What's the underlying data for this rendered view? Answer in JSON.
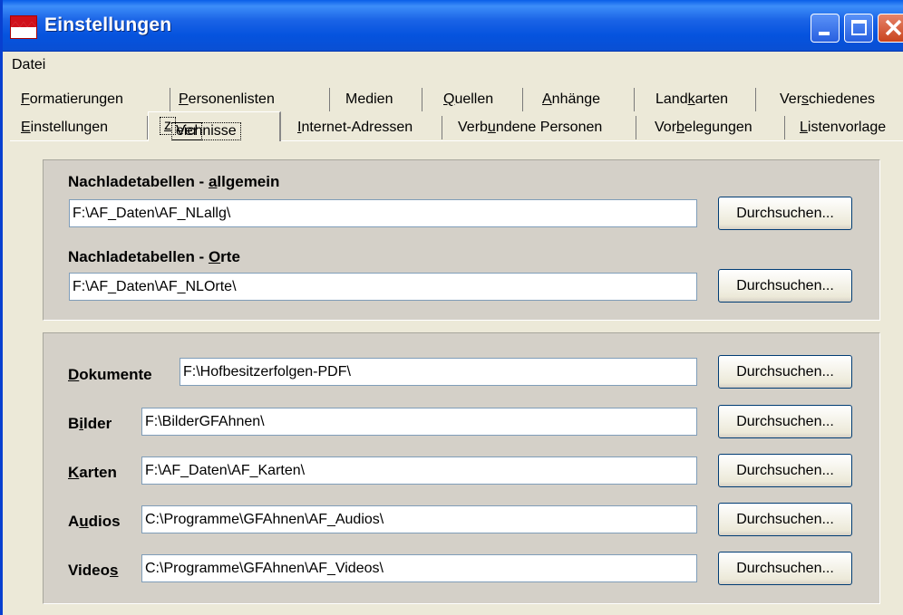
{
  "window": {
    "title": "Einstellungen"
  },
  "menu": {
    "items": [
      "Datei"
    ]
  },
  "tabs_row1": [
    {
      "pre": "",
      "key": "F",
      "post": "ormatierungen"
    },
    {
      "pre": "",
      "key": "P",
      "post": "ersonenlisten"
    },
    {
      "pre": "Medien",
      "key": "",
      "post": ""
    },
    {
      "pre": "",
      "key": "Q",
      "post": "uellen"
    },
    {
      "pre": "",
      "key": "A",
      "post": "nhänge"
    },
    {
      "pre": "Land",
      "key": "k",
      "post": "arten"
    },
    {
      "pre": "Ver",
      "key": "s",
      "post": "chiedenes"
    }
  ],
  "tabs_row2": [
    {
      "pre": "",
      "key": "E",
      "post": "instellungen"
    },
    {
      "pre": "Ver",
      "key": "z",
      "post": "eichnisse"
    },
    {
      "pre": "",
      "key": "I",
      "post": "nternet-Adressen"
    },
    {
      "pre": "Verb",
      "key": "u",
      "post": "ndene Personen"
    },
    {
      "pre": "Vor",
      "key": "b",
      "post": "elegungen"
    },
    {
      "pre": "",
      "key": "L",
      "post": "istenvorlage"
    }
  ],
  "nachlade": {
    "allgemein": {
      "label_pre": "Nachladetabellen - ",
      "label_key": "a",
      "label_post": "llgemein",
      "value": "F:\\AF_Daten\\AF_NLallg\\"
    },
    "orte": {
      "label_pre": "Nachladetabellen - ",
      "label_key": "O",
      "label_post": "rte",
      "value": "F:\\AF_Daten\\AF_NLOrte\\"
    }
  },
  "dirs": {
    "dokumente": {
      "label_pre": "",
      "label_key": "D",
      "label_post": "okumente",
      "value": "F:\\Hofbesitzerfolgen-PDF\\"
    },
    "bilder": {
      "label_pre": "B",
      "label_key": "i",
      "label_post": "lder",
      "value": "F:\\BilderGFAhnen\\"
    },
    "karten": {
      "label_pre": "",
      "label_key": "K",
      "label_post": "arten",
      "value": "F:\\AF_Daten\\AF_Karten\\"
    },
    "audios": {
      "label_pre": "A",
      "label_key": "u",
      "label_post": "dios",
      "value": "C:\\Programme\\GFAhnen\\AF_Audios\\"
    },
    "videos": {
      "label_pre": "Video",
      "label_key": "s",
      "label_post": "",
      "value": "C:\\Programme\\GFAhnen\\AF_Videos\\"
    }
  },
  "browse_label": "Durchsuchen..."
}
